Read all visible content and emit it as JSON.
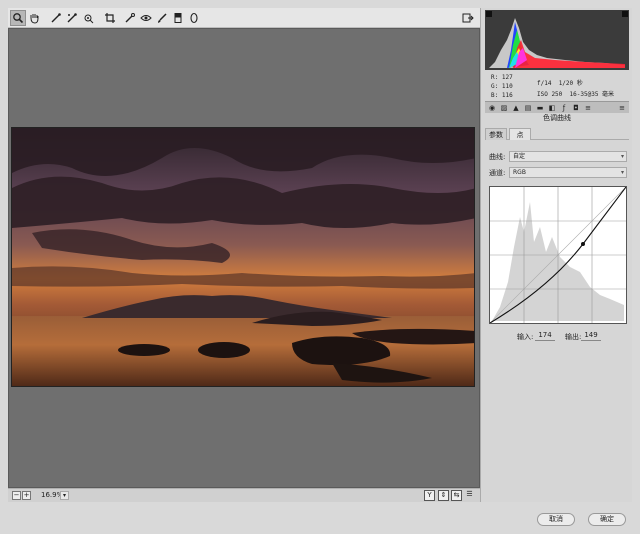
{
  "toolbar": {
    "tools": [
      {
        "name": "zoom-tool",
        "glyph": "🔍"
      },
      {
        "name": "hand-tool",
        "glyph": "✋"
      },
      {
        "name": "white-balance-tool",
        "glyph": "╱"
      },
      {
        "name": "color-sampler-tool",
        "glyph": "⟋"
      },
      {
        "name": "targeted-adjust-tool",
        "glyph": "⊙"
      },
      {
        "name": "crop-tool",
        "glyph": "⌗"
      },
      {
        "name": "spot-removal-tool",
        "glyph": "✧"
      },
      {
        "name": "red-eye-tool",
        "glyph": "◉"
      },
      {
        "name": "adjustment-brush-tool",
        "glyph": "✎"
      },
      {
        "name": "graduated-filter-tool",
        "glyph": "▯"
      },
      {
        "name": "radial-filter-tool",
        "glyph": "○"
      }
    ],
    "open_preferences_glyph": "⇥"
  },
  "info": {
    "r_label": "R:",
    "r_value": "127",
    "g_label": "G:",
    "g_value": "110",
    "b_label": "B:",
    "b_value": "116",
    "aperture": "f/14",
    "shutter": "1/20 秒",
    "iso": "ISO 250",
    "lens": "16-35@35 毫米"
  },
  "panel": {
    "section_title": "色调曲线",
    "subtabs": [
      "参数",
      "点"
    ],
    "curve_label": "曲线:",
    "curve_value": "自定",
    "channel_label": "通道:",
    "channel_value": "RGB",
    "input_label": "输入:",
    "input_value": "174",
    "output_label": "输出:",
    "output_value": "149"
  },
  "bottom": {
    "zoom_level": "16.9%",
    "minus": "−",
    "plus": "+",
    "view_y": "Y"
  },
  "buttons": {
    "cancel": "取消",
    "ok": "确定"
  },
  "colors": {
    "canvas_bg": "#6f6f6f",
    "panel_bg": "#d6d6d6",
    "sky_top": "#3b2a35",
    "sky_glow": "#e08a45"
  }
}
